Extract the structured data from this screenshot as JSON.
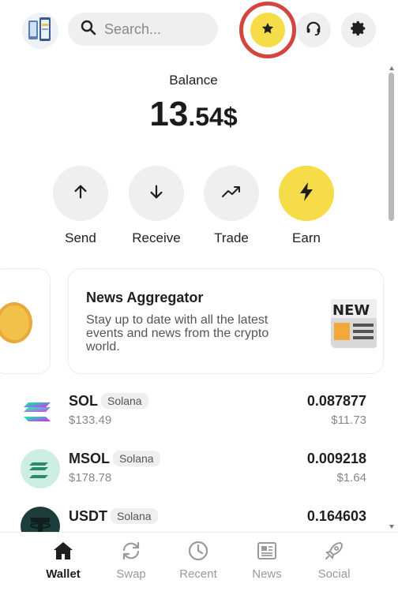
{
  "header": {
    "search_placeholder": "Search...",
    "icons": [
      "app-logo",
      "search-icon",
      "star-icon",
      "headset-icon",
      "gear-icon"
    ],
    "highlight_color": "#d2463f",
    "accent": "#f7dc4a"
  },
  "balance": {
    "label": "Balance",
    "whole": "13",
    "fraction": ".54$"
  },
  "actions": [
    {
      "label": "Send",
      "icon": "arrow-up-icon"
    },
    {
      "label": "Receive",
      "icon": "arrow-down-icon"
    },
    {
      "label": "Trade",
      "icon": "trend-icon"
    },
    {
      "label": "Earn",
      "icon": "bolt-icon"
    }
  ],
  "banner": {
    "title": "News Aggregator",
    "description": "Stay up to date with all the latest events and news from the crypto world.",
    "image_text": "NEW"
  },
  "tokens": [
    {
      "symbol": "SOL",
      "name": "Solana",
      "price": "$133.49",
      "amount": "0.087877",
      "value": "$11.73"
    },
    {
      "symbol": "MSOL",
      "name": "Solana",
      "price": "$178.78",
      "amount": "0.009218",
      "value": "$1.64"
    },
    {
      "symbol": "USDT",
      "name": "Solana",
      "price": "",
      "amount": "0.164603",
      "value": ""
    }
  ],
  "nav": [
    {
      "label": "Wallet",
      "icon": "home-icon",
      "active": true
    },
    {
      "label": "Swap",
      "icon": "swap-icon",
      "active": false
    },
    {
      "label": "Recent",
      "icon": "clock-icon",
      "active": false
    },
    {
      "label": "News",
      "icon": "newspaper-icon",
      "active": false
    },
    {
      "label": "Social",
      "icon": "rocket-icon",
      "active": false
    }
  ]
}
